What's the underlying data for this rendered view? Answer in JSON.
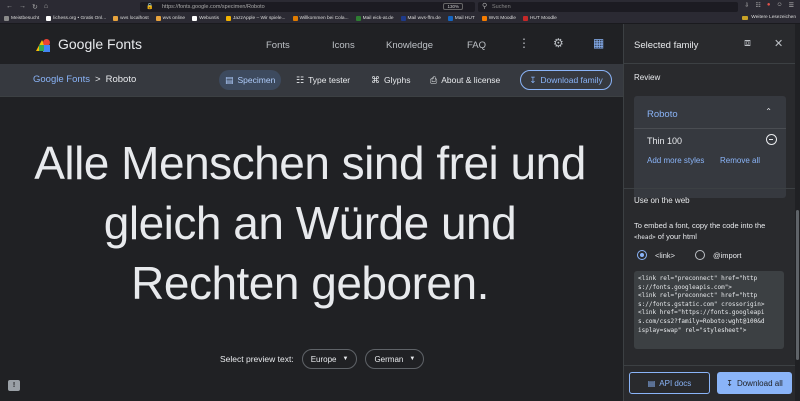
{
  "browser": {
    "url": "https://fonts.google.com/specimen/Roboto",
    "zoom": "130%",
    "search_placeholder": "Suchen",
    "bookmarks": [
      {
        "label": "Meistbesucht",
        "color": "#8a8a8a"
      },
      {
        "label": "lichess.org • Gratis Onl...",
        "color": "#ffffff"
      },
      {
        "label": "wvs localhost",
        "color": "#e8a33d"
      },
      {
        "label": "wvs online",
        "color": "#e8a33d"
      },
      {
        "label": "Webuntis",
        "color": "#ffffff"
      },
      {
        "label": "JazzApple – Wir spiele...",
        "color": "#f2b200"
      },
      {
        "label": "Willkommen bei Cola...",
        "color": "#e07b00"
      },
      {
        "label": "Mail eick-at.de",
        "color": "#2e7d32"
      },
      {
        "label": "Mail wvs-ffm.de",
        "color": "#1e3a8a"
      },
      {
        "label": "Mail HUT",
        "color": "#1565c0"
      },
      {
        "label": "WvS Moodle",
        "color": "#f57c00"
      },
      {
        "label": "HUT Moodle",
        "color": "#c62828"
      }
    ],
    "bookmarks_more": "Weitere Lesezeichen"
  },
  "header": {
    "logo_text": "Google Fonts",
    "nav": [
      "Fonts",
      "Icons",
      "Knowledge",
      "FAQ"
    ]
  },
  "subbar": {
    "breadcrumb_root": "Google Fonts",
    "breadcrumb_sep": ">",
    "breadcrumb_current": "Roboto",
    "tabs": [
      {
        "label": "Specimen",
        "icon": "▤"
      },
      {
        "label": "Type tester",
        "icon": "☷"
      },
      {
        "label": "Glyphs",
        "icon": "⌘"
      },
      {
        "label": "About & license",
        "icon": "⎙"
      }
    ],
    "download_label": "Download family"
  },
  "specimen": {
    "sample_text": "Alle Menschen sind frei und gleich an Würde und Rechten geboren.",
    "preview_label": "Select preview text:",
    "region": "Europe",
    "language": "German"
  },
  "panel": {
    "title": "Selected family",
    "review_label": "Review",
    "family": "Roboto",
    "variant": "Thin 100",
    "add_more": "Add more styles",
    "remove_all": "Remove all",
    "use_label": "Use on the web",
    "embed_intro": "To embed a font, copy the code into the",
    "embed_tag": "<head>",
    "embed_suffix": "of your html",
    "radio_link": "<link>",
    "radio_import": "@import",
    "code_lines": [
      "<link rel=\"preconnect\" href=\"http",
      "s://fonts.googleapis.com\">",
      "<link rel=\"preconnect\" href=\"http",
      "s://fonts.gstatic.com\" crossorigin>",
      "<link href=\"https://fonts.googleapi",
      "s.com/css2?family=Roboto:wght@100&d",
      "isplay=swap\" rel=\"stylesheet\">"
    ],
    "api_docs": "API docs",
    "download_all": "Download all"
  }
}
